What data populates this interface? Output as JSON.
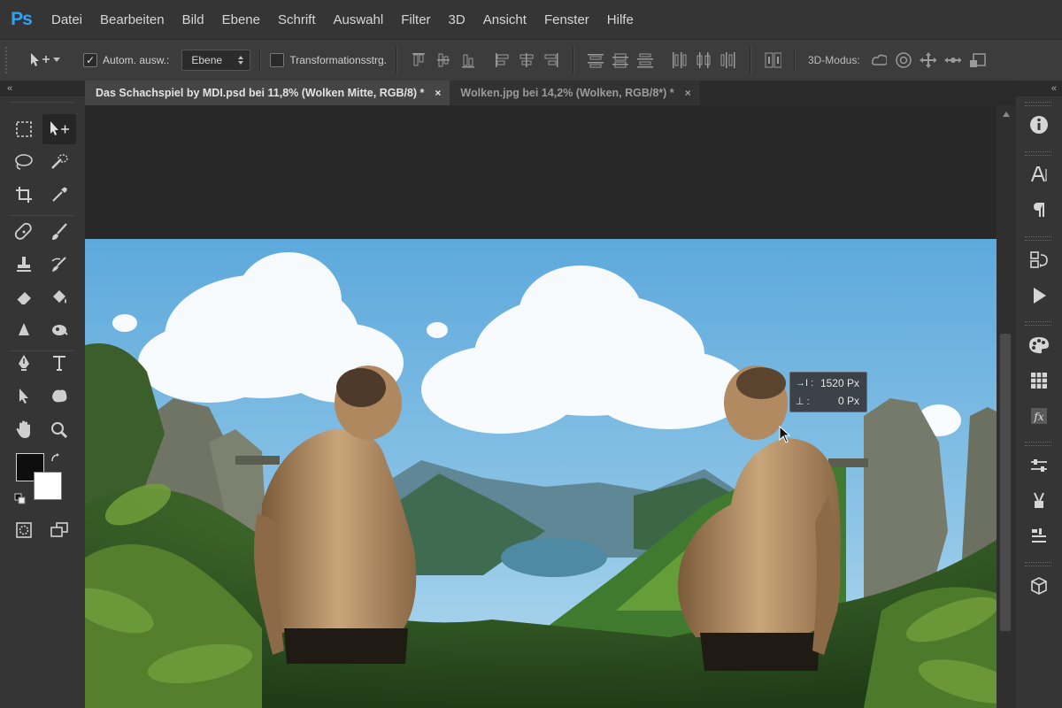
{
  "app": {
    "logo": "Ps"
  },
  "menu": [
    "Datei",
    "Bearbeiten",
    "Bild",
    "Ebene",
    "Schrift",
    "Auswahl",
    "Filter",
    "3D",
    "Ansicht",
    "Fenster",
    "Hilfe"
  ],
  "options": {
    "auto_select_label": "Autom. ausw.:",
    "auto_select_checked": "✓",
    "auto_select_value": "Ebene",
    "transform_label": "Transformationsstrg.",
    "mode3d_label": "3D-Modus:"
  },
  "tabs": [
    {
      "title": "Das Schachspiel by MDI.psd bei 11,8% (Wolken Mitte, RGB/8) *",
      "close": "×"
    },
    {
      "title": "Wolken.jpg bei 14,2% (Wolken, RGB/8*) *",
      "close": "×"
    }
  ],
  "panel_collapse": "«",
  "tooltip": {
    "row1_label": "→I :",
    "row1_value": "1520 Px",
    "row2_label": "⊥ :",
    "row2_value": "0 Px"
  },
  "icons": {
    "tools": [
      "marquee-icon",
      "move-icon",
      "lasso-icon",
      "quick-select-icon",
      "crop-icon",
      "eyedropper-icon",
      "healing-brush-icon",
      "brush-icon",
      "clone-stamp-icon",
      "history-brush-icon",
      "eraser-icon",
      "paint-bucket-icon",
      "blur-icon",
      "dodge-icon",
      "pen-icon",
      "type-icon",
      "path-select-icon",
      "shape-icon",
      "hand-icon",
      "zoom-icon"
    ],
    "right": [
      "info-icon",
      "character-icon",
      "paragraph-icon",
      "history-icon",
      "actions-icon",
      "color-icon",
      "swatches-icon",
      "styles-icon",
      "adjustments-icon",
      "brush-presets-icon",
      "layers-icon",
      "3d-icon"
    ]
  },
  "colors": {
    "foreground": "#0e0e0e",
    "background": "#ffffff",
    "accent": "#2fa3f2"
  }
}
